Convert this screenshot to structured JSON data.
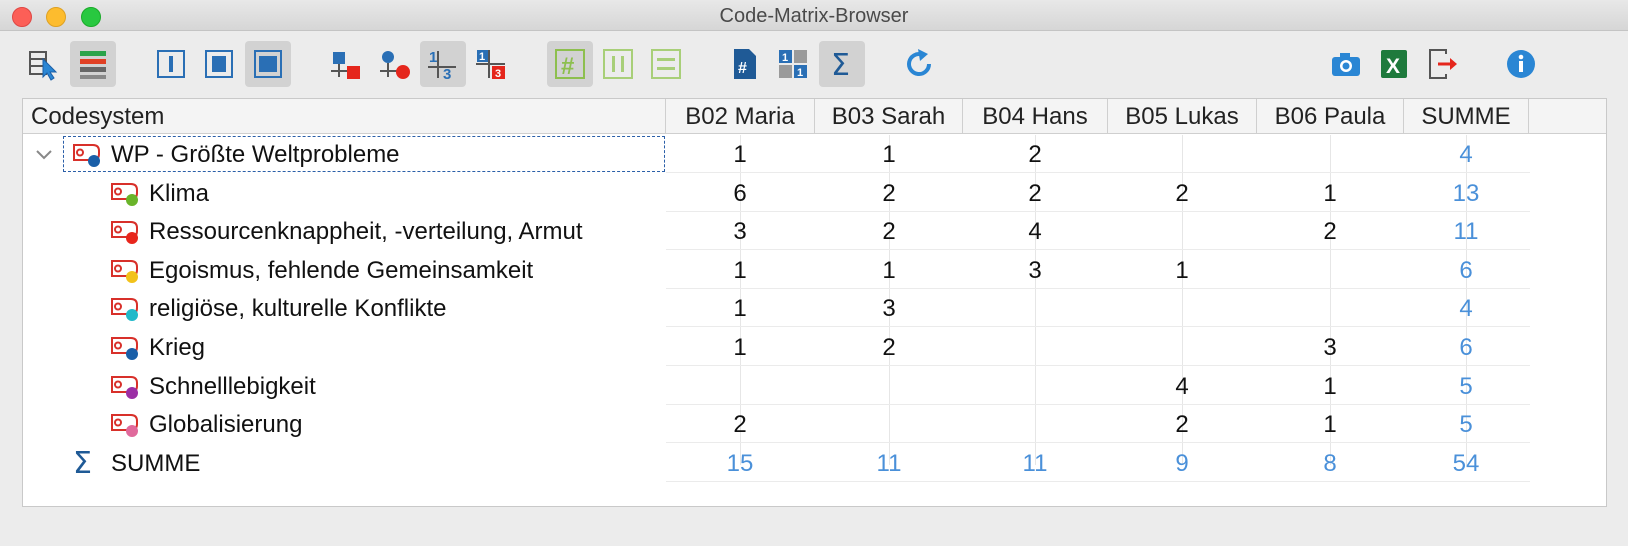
{
  "window": {
    "title": "Code-Matrix-Browser"
  },
  "toolbar": {
    "buttons": [
      {
        "icon": "select-cursor-icon",
        "active": false
      },
      {
        "icon": "color-bars-icon",
        "active": true
      },
      {
        "icon": "view-narrow-icon",
        "active": false
      },
      {
        "icon": "view-medium-icon",
        "active": false
      },
      {
        "icon": "view-wide-icon",
        "active": true
      },
      {
        "icon": "squares-symbol-icon",
        "active": false
      },
      {
        "icon": "circles-symbol-icon",
        "active": false
      },
      {
        "icon": "numbers-symbol-icon",
        "active": true
      },
      {
        "icon": "numbers-red-icon",
        "active": false
      },
      {
        "icon": "hash-grid-icon",
        "active": true
      },
      {
        "icon": "columns-icon",
        "active": false
      },
      {
        "icon": "rows-icon",
        "active": false
      },
      {
        "icon": "document-hash-icon",
        "active": false
      },
      {
        "icon": "binary-grid-icon",
        "active": false
      },
      {
        "icon": "sigma-icon",
        "active": true
      },
      {
        "icon": "refresh-icon",
        "active": false
      },
      {
        "icon": "camera-icon",
        "active": false
      },
      {
        "icon": "excel-icon",
        "active": false
      },
      {
        "icon": "export-icon",
        "active": false
      },
      {
        "icon": "info-icon",
        "active": false
      }
    ]
  },
  "table": {
    "headers": [
      "Codesystem",
      "B02 Maria",
      "B03 Sarah",
      "B04 Hans",
      "B05 Lukas",
      "B06 Paula",
      "SUMME"
    ],
    "parent": {
      "label": "WP - Größte Weltprobleme",
      "dot": "#1a5fa8",
      "values": [
        "1",
        "1",
        "2",
        "",
        ""
      ],
      "sum": "4"
    },
    "rows": [
      {
        "label": "Klima",
        "dot": "#6ab42a",
        "values": [
          "6",
          "2",
          "2",
          "2",
          "1"
        ],
        "sum": "13"
      },
      {
        "label": "Ressourcenknappheit, -verteilung, Armut",
        "dot": "#e8261c",
        "values": [
          "3",
          "2",
          "4",
          "",
          "2"
        ],
        "sum": "11"
      },
      {
        "label": "Egoismus, fehlende Gemeinsamkeit",
        "dot": "#f2c21b",
        "values": [
          "1",
          "1",
          "3",
          "1",
          ""
        ],
        "sum": "6"
      },
      {
        "label": "religiöse, kulturelle Konflikte",
        "dot": "#22b9c9",
        "values": [
          "1",
          "3",
          "",
          "",
          ""
        ],
        "sum": "4"
      },
      {
        "label": "Krieg",
        "dot": "#1a5fa8",
        "values": [
          "1",
          "2",
          "",
          "",
          "3"
        ],
        "sum": "6"
      },
      {
        "label": "Schnelllebigkeit",
        "dot": "#9b2ea5",
        "values": [
          "",
          "",
          "",
          "4",
          "1"
        ],
        "sum": "5"
      },
      {
        "label": "Globalisierung",
        "dot": "#e06a9c",
        "values": [
          "2",
          "",
          "",
          "2",
          "1"
        ],
        "sum": "5"
      }
    ],
    "total": {
      "label": "SUMME",
      "values": [
        "15",
        "11",
        "11",
        "9",
        "8"
      ],
      "sum": "54"
    }
  },
  "colors": {
    "sum_text": "#4a90d9",
    "selection_border": "#2b5fa8"
  }
}
